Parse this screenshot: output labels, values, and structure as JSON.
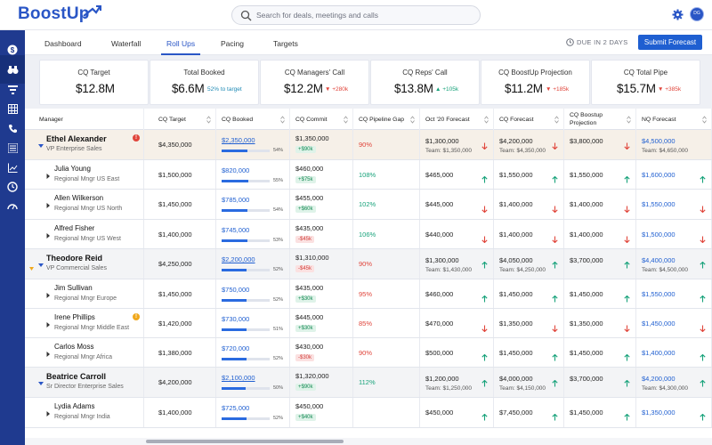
{
  "app": {
    "logo_text": "BoostUp",
    "avatar_initials": "DG"
  },
  "search": {
    "placeholder": "Search for deals, meetings and calls"
  },
  "tabs": [
    {
      "label": "Dashboard"
    },
    {
      "label": "Waterfall"
    },
    {
      "label": "Roll Ups",
      "active": true
    },
    {
      "label": "Pacing"
    },
    {
      "label": "Targets"
    }
  ],
  "due_label": "DUE IN 2 DAYS",
  "submit_label": "Submit Forecast",
  "kpis": [
    {
      "label": "CQ Target",
      "value": "$12.8M",
      "delta": "",
      "delta_type": ""
    },
    {
      "label": "Total Booked",
      "value": "$6.6M",
      "delta": "52% to target",
      "delta_type": "info"
    },
    {
      "label": "CQ Managers' Call",
      "value": "$12.2M",
      "delta": "+280k",
      "delta_type": "down"
    },
    {
      "label": "CQ Reps' Call",
      "value": "$13.8M",
      "delta": "+105k",
      "delta_type": "up"
    },
    {
      "label": "CQ BoostUp Projection",
      "value": "$11.2M",
      "delta": "+185k",
      "delta_type": "down"
    },
    {
      "label": "CQ Total Pipe",
      "value": "$15.7M",
      "delta": "+385k",
      "delta_type": "down"
    }
  ],
  "columns": {
    "manager": "Manager",
    "cq_target": "CQ Target",
    "cq_booked": "CQ Booked",
    "cq_commit": "CQ Commit",
    "cq_pipeline_gap": "CQ Pipeline Gap",
    "oct_forecast": "Oct '20 Forecast",
    "cq_forecast": "CQ Forecast",
    "cq_boostup_projection_l1": "CQ Boostup",
    "cq_boostup_projection_l2": "Projection",
    "nq_forecast": "NQ Forecast"
  },
  "rows": [
    {
      "type": "parent",
      "name": "Ethel Alexander",
      "role": "VP Enterprise Sales",
      "badge": "!",
      "badge_color": "#e0453b",
      "target": "$4,350,000",
      "booked": "$2,350,000",
      "booked_pct": "54%",
      "booked_frac": 0.54,
      "commit": "$1,350,000",
      "commit_chip": "+$90k",
      "commit_chip_type": "up",
      "gap": "90%",
      "gap_type": "red",
      "oct": "$1,300,000",
      "oct_team": "Team: $1,350,000",
      "oct_dir": "down",
      "cqf": "$4,200,000",
      "cqf_team": "Team: $4,350,000",
      "cqf_dir": "down",
      "proj": "$3,800,000",
      "proj_dir": "down",
      "nq": "$4,500,000",
      "nq_team": "Team: $4,650,000",
      "nq_dir": "",
      "first": true
    },
    {
      "type": "child",
      "name": "Julia Young",
      "role": "Regional Mngr US East",
      "target": "$1,500,000",
      "booked": "$820,000",
      "booked_pct": "55%",
      "booked_frac": 0.55,
      "commit": "$460,000",
      "commit_chip": "+$75k",
      "commit_chip_type": "up",
      "gap": "108%",
      "gap_type": "green",
      "oct": "$465,000",
      "oct_dir": "up",
      "cqf": "$1,550,000",
      "cqf_dir": "up",
      "proj": "$1,550,000",
      "proj_dir": "up",
      "nq": "$1,600,000",
      "nq_dir": "up"
    },
    {
      "type": "child",
      "name": "Allen Wilkerson",
      "role": "Regional Mngr US North",
      "target": "$1,450,000",
      "booked": "$785,000",
      "booked_pct": "54%",
      "booked_frac": 0.54,
      "commit": "$455,000",
      "commit_chip": "+$60k",
      "commit_chip_type": "up",
      "gap": "102%",
      "gap_type": "green",
      "oct": "$445,000",
      "oct_dir": "down",
      "cqf": "$1,400,000",
      "cqf_dir": "down",
      "proj": "$1,400,000",
      "proj_dir": "down",
      "nq": "$1,550,000",
      "nq_dir": "down"
    },
    {
      "type": "child",
      "name": "Alfred Fisher",
      "role": "Regional Mngr US West",
      "target": "$1,400,000",
      "booked": "$745,000",
      "booked_pct": "53%",
      "booked_frac": 0.53,
      "commit": "$435,000",
      "commit_chip": "-$45k",
      "commit_chip_type": "down",
      "gap": "106%",
      "gap_type": "green",
      "oct": "$440,000",
      "oct_dir": "down",
      "cqf": "$1,400,000",
      "cqf_dir": "down",
      "proj": "$1,400,000",
      "proj_dir": "down",
      "nq": "$1,500,000",
      "nq_dir": "down"
    },
    {
      "type": "parent",
      "name": "Theodore Reid",
      "role": "VP Commercial Sales",
      "sidemark": true,
      "target": "$4,250,000",
      "booked": "$2,200,000",
      "booked_pct": "52%",
      "booked_frac": 0.52,
      "commit": "$1,310,000",
      "commit_chip": "-$45k",
      "commit_chip_type": "down",
      "gap": "90%",
      "gap_type": "red",
      "oct": "$1,300,000",
      "oct_team": "Team: $1,430,000",
      "oct_dir": "up",
      "cqf": "$4,050,000",
      "cqf_team": "Team: $4,250,000",
      "cqf_dir": "up",
      "proj": "$3,700,000",
      "proj_dir": "up",
      "nq": "$4,400,000",
      "nq_team": "Team: $4,500,000",
      "nq_dir": "up"
    },
    {
      "type": "child",
      "name": "Jim Sullivan",
      "role": "Regional Mngr Europe",
      "target": "$1,450,000",
      "booked": "$750,000",
      "booked_pct": "52%",
      "booked_frac": 0.52,
      "commit": "$435,000",
      "commit_chip": "+$30k",
      "commit_chip_type": "up",
      "gap": "95%",
      "gap_type": "red",
      "oct": "$460,000",
      "oct_dir": "up",
      "cqf": "$1,450,000",
      "cqf_dir": "up",
      "proj": "$1,450,000",
      "proj_dir": "up",
      "nq": "$1,550,000",
      "nq_dir": "up"
    },
    {
      "type": "child",
      "name": "Irene Phillips",
      "role": "Regional Mngr Middle East",
      "badge": "!",
      "badge_color": "#f0a81c",
      "target": "$1,420,000",
      "booked": "$730,000",
      "booked_pct": "51%",
      "booked_frac": 0.51,
      "commit": "$445,000",
      "commit_chip": "+$30k",
      "commit_chip_type": "up",
      "gap": "85%",
      "gap_type": "red",
      "oct": "$470,000",
      "oct_dir": "down",
      "cqf": "$1,350,000",
      "cqf_dir": "down",
      "proj": "$1,350,000",
      "proj_dir": "down",
      "nq": "$1,450,000",
      "nq_dir": "down"
    },
    {
      "type": "child",
      "name": "Carlos Moss",
      "role": "Regional Mngr Africa",
      "target": "$1,380,000",
      "booked": "$720,000",
      "booked_pct": "52%",
      "booked_frac": 0.52,
      "commit": "$430,000",
      "commit_chip": "-$30k",
      "commit_chip_type": "down",
      "gap": "90%",
      "gap_type": "red",
      "oct": "$500,000",
      "oct_dir": "up",
      "cqf": "$1,450,000",
      "cqf_dir": "up",
      "proj": "$1,450,000",
      "proj_dir": "up",
      "nq": "$1,400,000",
      "nq_dir": "up"
    },
    {
      "type": "parent",
      "name": "Beatrice Carroll",
      "role": "Sr Director Enterprise Sales",
      "target": "$4,200,000",
      "booked": "$2,100,000",
      "booked_pct": "50%",
      "booked_frac": 0.5,
      "commit": "$1,320,000",
      "commit_chip": "+$90k",
      "commit_chip_type": "up",
      "gap": "112%",
      "gap_type": "green",
      "oct": "$1,200,000",
      "oct_team": "Team: $1,250,000",
      "oct_dir": "up",
      "cqf": "$4,000,000",
      "cqf_team": "Team: $4,150,000",
      "cqf_dir": "up",
      "proj": "$3,700,000",
      "proj_dir": "up",
      "nq": "$4,200,000",
      "nq_team": "Team: $4,300,000",
      "nq_dir": "up"
    },
    {
      "type": "child",
      "name": "Lydia Adams",
      "role": "Regional Mngr India",
      "target": "$1,400,000",
      "booked": "$725,000",
      "booked_pct": "52%",
      "booked_frac": 0.52,
      "commit": "$450,000",
      "commit_chip": "+$40k",
      "commit_chip_type": "up",
      "gap": "",
      "gap_type": "",
      "oct": "$450,000",
      "oct_dir": "up",
      "cqf": "$7,450,000",
      "cqf_dir": "up",
      "proj": "$1,450,000",
      "proj_dir": "up",
      "nq": "$1,350,000",
      "nq_dir": "up"
    }
  ],
  "colors": {
    "brand": "#2a56c6",
    "sidebar": "#1f3a8f",
    "up": "#17a27a",
    "down": "#e0453b",
    "bar": "#2a6be0"
  }
}
